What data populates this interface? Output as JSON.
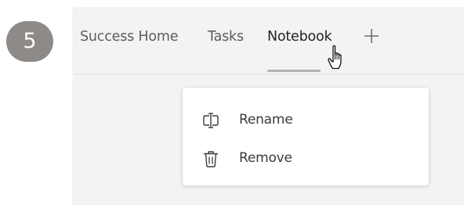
{
  "step": {
    "number": "5"
  },
  "tabs": [
    {
      "label": "Success Home",
      "active": false
    },
    {
      "label": "Tasks",
      "active": false
    },
    {
      "label": "Notebook",
      "active": true
    }
  ],
  "add_tab": {
    "icon": "plus-icon"
  },
  "cursor": {
    "icon": "hand-pointer-icon"
  },
  "context_menu": {
    "items": [
      {
        "label": "Rename",
        "icon": "rename-icon"
      },
      {
        "label": "Remove",
        "icon": "trash-icon"
      }
    ]
  },
  "colors": {
    "badge": "#8e8a87",
    "panel_background": "#f4f3f3",
    "tab_text": "#5e5c5a",
    "active_tab_text": "#252423",
    "active_underline": "#b4b2b0",
    "menu_text": "#3b3a39"
  }
}
